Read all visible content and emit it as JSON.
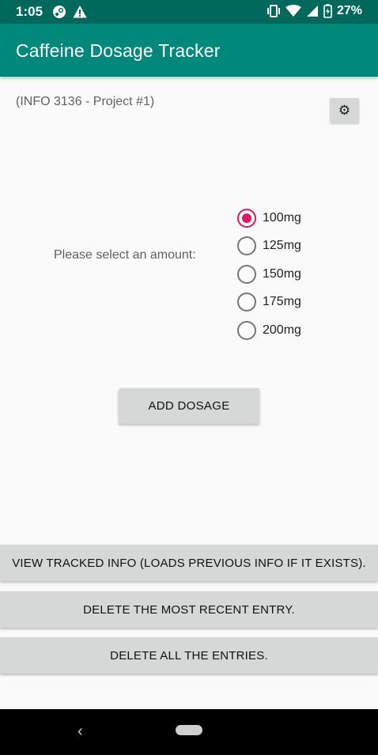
{
  "status_bar": {
    "time": "1:05",
    "battery_percent": "27%",
    "left_icons": [
      "steam-notification-icon",
      "warning-icon"
    ],
    "right_icons": [
      "vibrate-icon",
      "wifi-icon",
      "signal-icon",
      "battery-charging-icon"
    ]
  },
  "app_bar": {
    "title": "Caffeine Dosage Tracker",
    "color": "#00897b"
  },
  "header": {
    "subtitle": "(INFO 3136 - Project #1)",
    "settings_icon": "gear-icon"
  },
  "dosage": {
    "label": "Please select an amount:",
    "options": [
      "100mg",
      "125mg",
      "150mg",
      "175mg",
      "200mg"
    ],
    "selected": "100mg",
    "accent_color": "#d81b60"
  },
  "buttons": {
    "add": "ADD DOSAGE",
    "view": "VIEW TRACKED INFO (LOADS PREVIOUS INFO IF IT EXISTS).",
    "delete_recent": "DELETE THE MOST RECENT ENTRY.",
    "delete_all": "DELETE ALL THE ENTRIES."
  },
  "nav_bar": {
    "back_icon": "back-icon",
    "home_icon": "home-pill-icon"
  }
}
